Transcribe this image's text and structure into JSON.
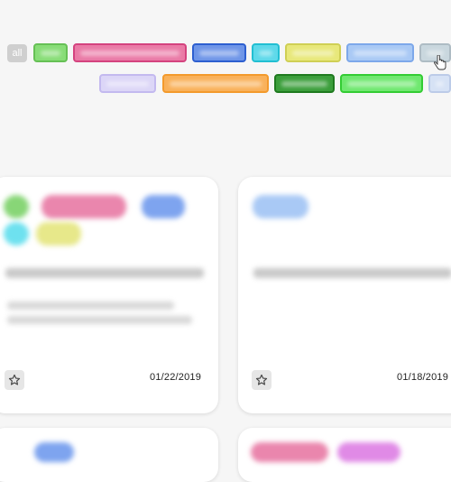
{
  "filters": {
    "all_label": "all",
    "tags": [
      {
        "name": "green-light",
        "color": "#88dd77",
        "border": "#66c055"
      },
      {
        "name": "pink",
        "color": "#ea7aa6",
        "border": "#d4437f"
      },
      {
        "name": "blue",
        "color": "#6e95e8",
        "border": "#2d5fd0"
      },
      {
        "name": "cyan",
        "color": "#5ed9ea",
        "border": "#22bfd2"
      },
      {
        "name": "yellow",
        "color": "#e8e87a",
        "border": "#cfcf55"
      },
      {
        "name": "light-blue",
        "color": "#a9c9f5",
        "border": "#7da8ea"
      },
      {
        "name": "grey-blue",
        "color": "#c9d7de",
        "border": "#aebcc4"
      },
      {
        "name": "lavender",
        "color": "#dcd6f7",
        "border": "#c3b9ef"
      },
      {
        "name": "orange",
        "color": "#f9b15a",
        "border": "#f39a2c"
      },
      {
        "name": "dark-green",
        "color": "#3b9e3b",
        "border": "#1f7a1f"
      },
      {
        "name": "bright-green",
        "color": "#6fe86f",
        "border": "#33cc33"
      },
      {
        "name": "pale-blue",
        "color": "#d6e2f5",
        "border": "#bccbe8"
      }
    ]
  },
  "cards": [
    {
      "date": "01/22/2019",
      "star_icon": "star-outline-icon"
    },
    {
      "date": "01/18/2019",
      "star_icon": "star-outline-icon"
    }
  ]
}
